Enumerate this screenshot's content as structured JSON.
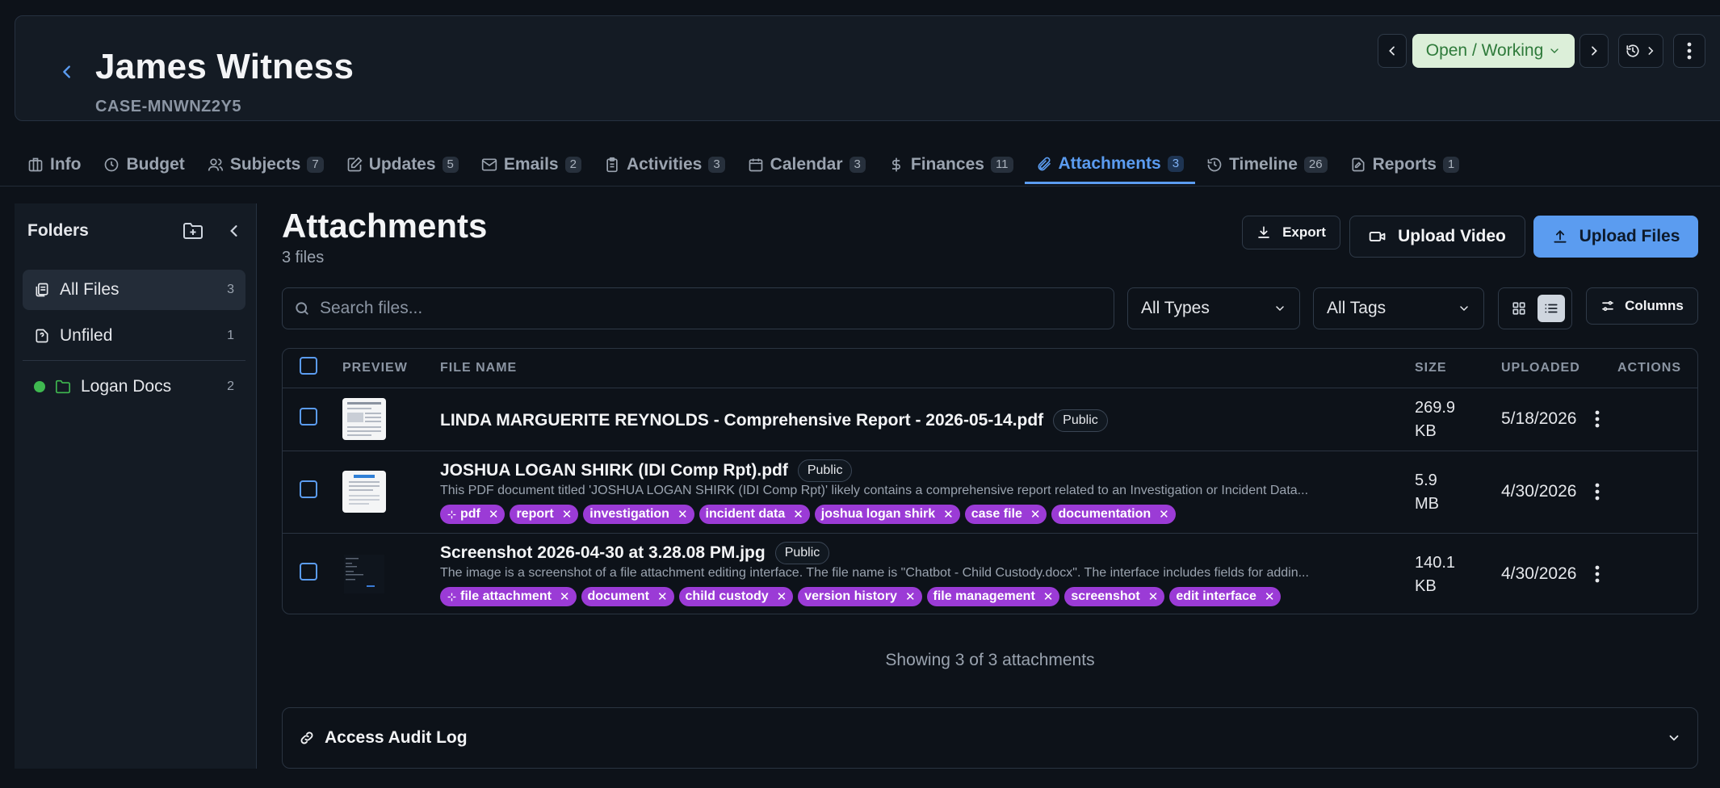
{
  "header": {
    "title": "James Witness",
    "case_id": "CASE-MNWNZ2Y5",
    "status": "Open / Working"
  },
  "tabs": [
    {
      "label": "Info",
      "count": null
    },
    {
      "label": "Budget",
      "count": null
    },
    {
      "label": "Subjects",
      "count": "7"
    },
    {
      "label": "Updates",
      "count": "5"
    },
    {
      "label": "Emails",
      "count": "2"
    },
    {
      "label": "Activities",
      "count": "3"
    },
    {
      "label": "Calendar",
      "count": "3"
    },
    {
      "label": "Finances",
      "count": "11"
    },
    {
      "label": "Attachments",
      "count": "3"
    },
    {
      "label": "Timeline",
      "count": "26"
    },
    {
      "label": "Reports",
      "count": "1"
    }
  ],
  "sidebar": {
    "heading": "Folders",
    "items": [
      {
        "label": "All Files",
        "count": "3"
      },
      {
        "label": "Unfiled",
        "count": "1"
      },
      {
        "label": "Logan Docs",
        "count": "2"
      }
    ]
  },
  "main": {
    "title": "Attachments",
    "subtitle": "3 files",
    "export_label": "Export",
    "upload_video_label": "Upload Video",
    "upload_files_label": "Upload Files",
    "search_placeholder": "Search files...",
    "type_filter": "All Types",
    "tag_filter": "All Tags",
    "columns_label": "Columns"
  },
  "table": {
    "headers": {
      "preview": "PREVIEW",
      "file_name": "FILE NAME",
      "size": "SIZE",
      "uploaded": "UPLOADED",
      "actions": "ACTIONS"
    },
    "rows": [
      {
        "name": "LINDA MARGUERITE REYNOLDS - Comprehensive Report - 2026-05-14.pdf",
        "visibility": "Public",
        "description": "",
        "tags": [],
        "size_line1": "269.9",
        "size_line2": "KB",
        "uploaded": "5/18/2026"
      },
      {
        "name": "JOSHUA LOGAN SHIRK (IDI Comp Rpt).pdf",
        "visibility": "Public",
        "description": "This PDF document titled 'JOSHUA LOGAN SHIRK (IDI Comp Rpt)' likely contains a comprehensive report related to an Investigation or Incident Data...",
        "tags": [
          "pdf",
          "report",
          "investigation",
          "incident data",
          "joshua logan shirk",
          "case file",
          "documentation"
        ],
        "size_line1": "5.9",
        "size_line2": "MB",
        "uploaded": "4/30/2026"
      },
      {
        "name": "Screenshot 2026-04-30 at 3.28.08 PM.jpg",
        "visibility": "Public",
        "description": "The image is a screenshot of a file attachment editing interface. The file name is \"Chatbot - Child Custody.docx\". The interface includes fields for addin...",
        "tags": [
          "file attachment",
          "document",
          "child custody",
          "version history",
          "file management",
          "screenshot",
          "edit interface"
        ],
        "size_line1": "140.1",
        "size_line2": "KB",
        "uploaded": "4/30/2026"
      }
    ]
  },
  "footer": {
    "showing": "Showing 3 of 3 attachments",
    "audit_label": "Access Audit Log"
  },
  "colors": {
    "accent": "#5b9cf0",
    "tag": "#9b3bd6",
    "status_bg": "#dcefd9",
    "folder_dot": "#3fb950"
  }
}
